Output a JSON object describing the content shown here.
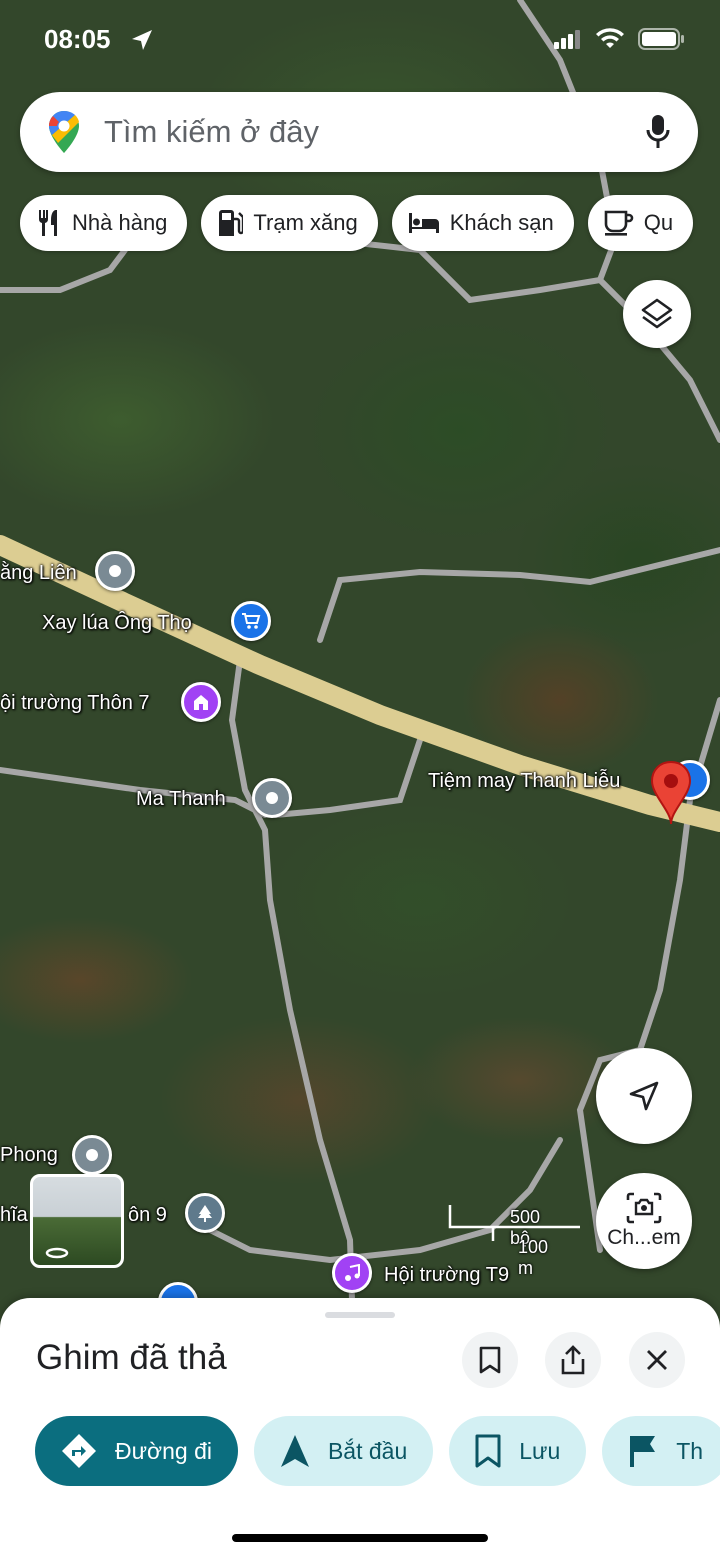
{
  "status_bar": {
    "time": "08:05"
  },
  "search": {
    "placeholder": "Tìm kiếm ở đây"
  },
  "chips": [
    {
      "label": "Nhà hàng",
      "icon": "fork-knife-icon"
    },
    {
      "label": "Trạm xăng",
      "icon": "gas-pump-icon"
    },
    {
      "label": "Khách sạn",
      "icon": "bed-icon"
    },
    {
      "label": "Qu",
      "icon": "coffee-cup-icon"
    }
  ],
  "map": {
    "labels": {
      "lang_lien": "ằng Liên",
      "xay_lua": "Xay lúa Ông Thọ",
      "hoi_truong_7": "ội trường Thôn 7",
      "ma_thanh": "Ma Thanh",
      "tiem_may": "Tiệm may Thanh Liễu",
      "phong": "Phong",
      "thon9_left": "hĩa",
      "thon9_right": "ôn 9",
      "hoi_truong_t9": "Hội trường T9"
    },
    "scale": {
      "imperial": "500 bộ",
      "metric": "100 m"
    },
    "street_view_label": "Ch...em"
  },
  "sheet": {
    "title": "Ghim đã thả",
    "actions": [
      {
        "label": "Đường đi",
        "icon": "directions-icon"
      },
      {
        "label": "Bắt đầu",
        "icon": "navigation-arrow-icon"
      },
      {
        "label": "Lưu",
        "icon": "bookmark-icon"
      },
      {
        "label": "Th",
        "icon": "flag-icon"
      }
    ]
  },
  "colors": {
    "primary": "#0b6e7f",
    "tonal": "#d3f0f3",
    "pin_red": "#ea4335",
    "road_main": "#d8c98f",
    "road_minor": "#a9a9a9"
  }
}
